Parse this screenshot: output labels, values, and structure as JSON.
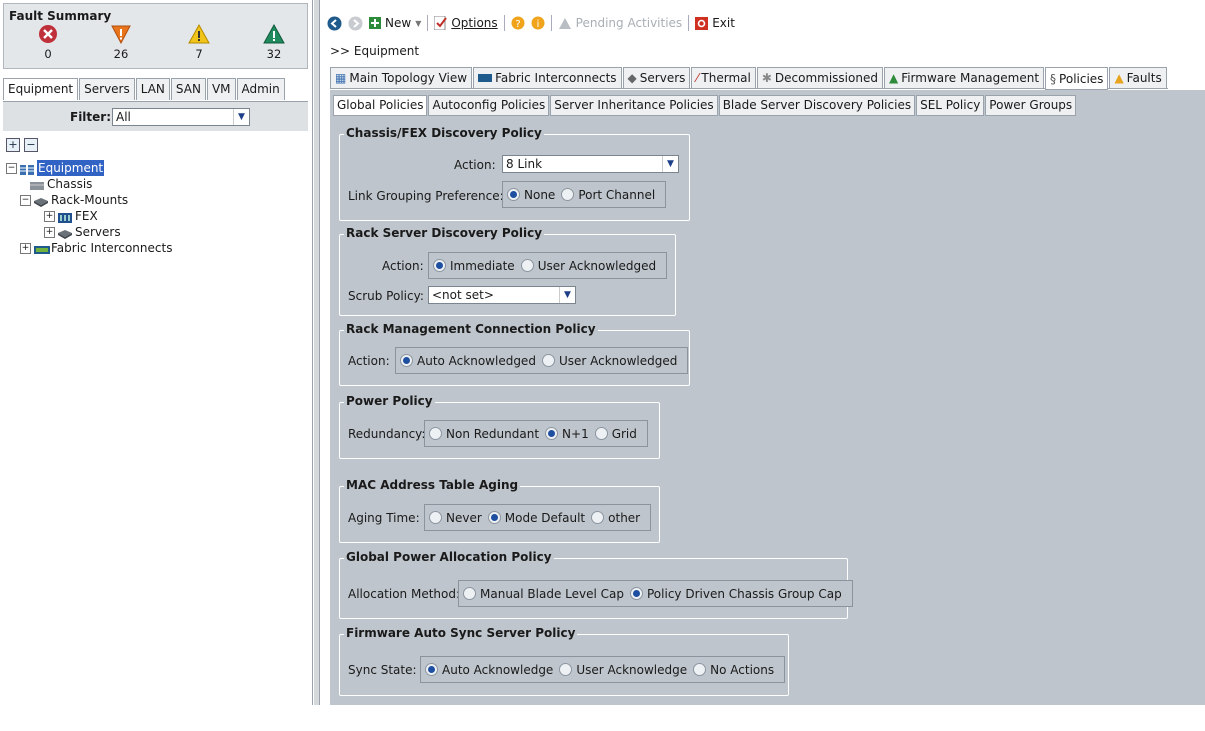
{
  "fault_summary": {
    "title": "Fault Summary",
    "items": [
      {
        "name": "critical",
        "count": "0",
        "icon": "critical-fault-icon",
        "color": "#c0303a"
      },
      {
        "name": "major",
        "count": "26",
        "icon": "major-fault-icon",
        "color": "#e8741c"
      },
      {
        "name": "minor",
        "count": "7",
        "icon": "minor-fault-icon",
        "color": "#f0c419"
      },
      {
        "name": "warning",
        "count": "32",
        "icon": "warning-fault-icon",
        "color": "#1e8a5e"
      }
    ]
  },
  "nav_tabs": [
    "Equipment",
    "Servers",
    "LAN",
    "SAN",
    "VM",
    "Admin"
  ],
  "filter": {
    "label": "Filter:",
    "value": "All"
  },
  "tree": {
    "root": "Equipment",
    "chassis": "Chassis",
    "rack_mounts": "Rack-Mounts",
    "fex": "FEX",
    "servers": "Servers",
    "fabric": "Fabric Interconnects"
  },
  "toolbar": {
    "new": "New",
    "options": "Options",
    "pending": "Pending Activities",
    "exit": "Exit"
  },
  "breadcrumb": ">> Equipment",
  "main_tabs": [
    "Main Topology View",
    "Fabric Interconnects",
    "Servers",
    "Thermal",
    "Decommissioned",
    "Firmware Management",
    "Policies",
    "Faults"
  ],
  "sub_tabs": [
    "Global Policies",
    "Autoconfig Policies",
    "Server Inheritance Policies",
    "Blade Server Discovery Policies",
    "SEL Policy",
    "Power Groups"
  ],
  "policies": {
    "chassis": {
      "title": "Chassis/FEX Discovery Policy",
      "action_label": "Action:",
      "action_value": "8 Link",
      "link_label": "Link Grouping Preference:",
      "link_options": [
        "None",
        "Port Channel"
      ]
    },
    "rack_discovery": {
      "title": "Rack Server Discovery Policy",
      "action_label": "Action:",
      "options": [
        "Immediate",
        "User Acknowledged"
      ],
      "scrub_label": "Scrub Policy:",
      "scrub_value": "<not set>"
    },
    "rack_mgmt": {
      "title": "Rack Management Connection Policy",
      "action_label": "Action:",
      "options": [
        "Auto Acknowledged",
        "User Acknowledged"
      ]
    },
    "power": {
      "title": "Power Policy",
      "label": "Redundancy:",
      "options": [
        "Non Redundant",
        "N+1",
        "Grid"
      ]
    },
    "mac": {
      "title": "MAC Address Table Aging",
      "label": "Aging Time:",
      "options": [
        "Never",
        "Mode Default",
        "other"
      ]
    },
    "global_power": {
      "title": "Global Power Allocation Policy",
      "label": "Allocation Method:",
      "options": [
        "Manual Blade Level Cap",
        "Policy Driven Chassis Group Cap"
      ]
    },
    "firmware": {
      "title": "Firmware Auto Sync Server Policy",
      "label": "Sync State:",
      "options": [
        "Auto Acknowledge",
        "User Acknowledge",
        "No Actions"
      ]
    }
  }
}
